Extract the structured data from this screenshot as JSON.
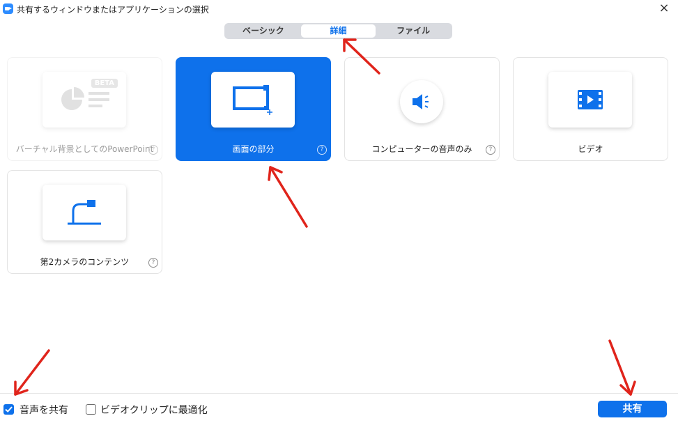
{
  "window": {
    "title": "共有するウィンドウまたはアプリケーションの選択",
    "close_icon": "×"
  },
  "tabs": [
    {
      "label": "ベーシック",
      "active": false
    },
    {
      "label": "詳細",
      "active": true
    },
    {
      "label": "ファイル",
      "active": false
    }
  ],
  "cards": [
    {
      "label": "バーチャル背景としてのPowerPoint",
      "badge": "BETA",
      "icon": "powerpoint-chart-icon",
      "state": "disabled",
      "help": "?"
    },
    {
      "label": "画面の部分",
      "icon": "screen-portion-icon",
      "state": "selected",
      "help": "?"
    },
    {
      "label": "コンピューターの音声のみ",
      "icon": "speaker-icon",
      "state": "normal",
      "help": "?"
    },
    {
      "label": "ビデオ",
      "icon": "video-icon",
      "state": "normal",
      "help": ""
    },
    {
      "label": "第2カメラのコンテンツ",
      "icon": "document-camera-icon",
      "state": "normal",
      "help": "?"
    }
  ],
  "footer": {
    "share_audio_label": "音声を共有",
    "share_audio_checked": true,
    "optimize_video_label": "ビデオクリップに最適化",
    "optimize_video_checked": false,
    "share_button_label": "共有"
  },
  "colors": {
    "accent": "#0E71EB",
    "annotation_arrow": "#E0241B"
  }
}
